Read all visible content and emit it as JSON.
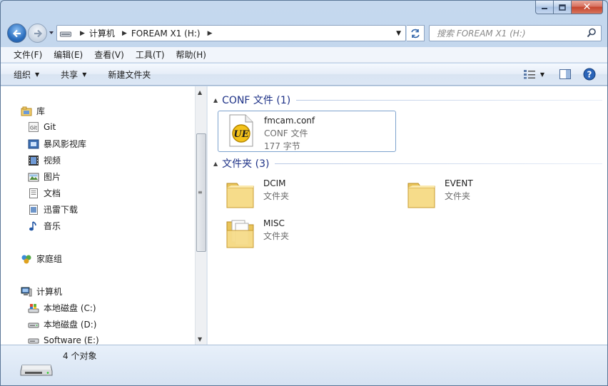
{
  "address_bar": {
    "crumbs": [
      "计算机",
      "FOREAM X1 (H:)"
    ]
  },
  "search": {
    "placeholder": "搜索 FOREAM X1 (H:)"
  },
  "menu": [
    "文件(F)",
    "编辑(E)",
    "查看(V)",
    "工具(T)",
    "帮助(H)"
  ],
  "toolbar": {
    "organize": "组织",
    "share": "共享",
    "new_folder": "新建文件夹"
  },
  "nav": {
    "libraries": "库",
    "library_items": [
      "Git",
      "暴风影视库",
      "视频",
      "图片",
      "文档",
      "迅雷下载",
      "音乐"
    ],
    "homegroup": "家庭组",
    "computer": "计算机",
    "drives": [
      "本地磁盘 (C:)",
      "本地磁盘 (D:)",
      "Software (E:)"
    ]
  },
  "groups": [
    {
      "title": "CONF 文件 (1)",
      "items": [
        {
          "name": "fmcam.conf",
          "type": "CONF 文件",
          "size": "177 字节",
          "icon": "ultraedit-icon"
        }
      ]
    },
    {
      "title": "文件夹 (3)",
      "items": [
        {
          "name": "DCIM",
          "type": "文件夹",
          "icon": "folder-icon"
        },
        {
          "name": "EVENT",
          "type": "文件夹",
          "icon": "folder-icon"
        },
        {
          "name": "MISC",
          "type": "文件夹",
          "icon": "folder-doc-icon"
        }
      ]
    }
  ],
  "status": {
    "count": "4 个对象"
  },
  "colors": {
    "accent": "#1e3287",
    "frame": "#b9d1ea"
  }
}
